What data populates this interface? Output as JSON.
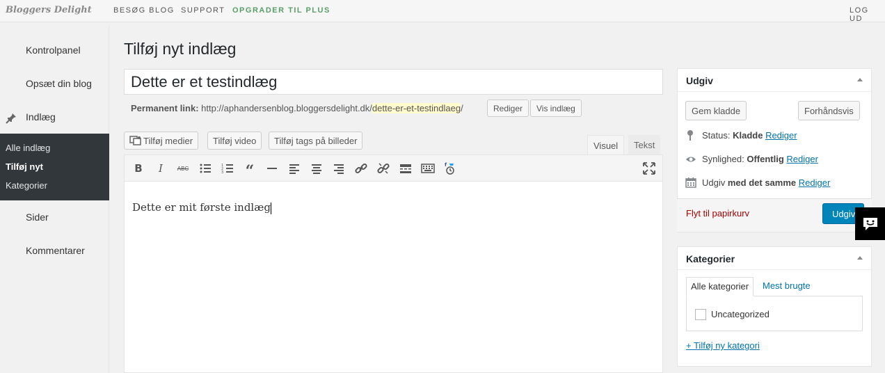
{
  "topbar": {
    "logo": "Bloggers Delight",
    "nav": [
      "BESØG BLOG",
      "SUPPORT",
      "OPGRADER TIL PLUS"
    ],
    "logout": "LOG UD"
  },
  "sidebar": {
    "items": [
      "Kontrolpanel",
      "Opsæt din blog",
      "Indlæg",
      "Sider",
      "Kommentarer"
    ],
    "submenu": [
      "Alle indlæg",
      "Tilføj nyt",
      "Kategorier"
    ]
  },
  "main": {
    "page_title": "Tilføj nyt indlæg",
    "post_title": "Dette er et testindlæg",
    "permalink_label": "Permanent link:",
    "permalink_base": "http://aphandersenblog.bloggersdelight.dk/",
    "permalink_slug": "dette-er-et-testindlaeg",
    "permalink_trail": "/",
    "edit_button": "Rediger",
    "view_button": "Vis indlæg",
    "media_buttons": [
      "Tilføj medier",
      "Tilføj video",
      "Tilføj tags på billeder"
    ],
    "tabs": [
      "Visuel",
      "Tekst"
    ],
    "content": "Dette er mit første indlæg"
  },
  "publish_box": {
    "title": "Udgiv",
    "save_draft": "Gem kladde",
    "preview": "Forhåndsvis",
    "status_label": "Status:",
    "status_value": "Kladde",
    "visibility_label": "Synlighed:",
    "visibility_value": "Offentlig",
    "publish_label": "Udgiv",
    "publish_value": "med det samme",
    "edit_link": "Rediger",
    "trash": "Flyt til papirkurv",
    "publish_button": "Udgiv"
  },
  "categories_box": {
    "title": "Kategorier",
    "tabs": [
      "Alle kategorier",
      "Mest brugte"
    ],
    "items": [
      "Uncategorized"
    ],
    "add_link": "+ Tilføj ny kategori"
  },
  "colors": {
    "accent": "#0085ba",
    "link": "#0073aa",
    "sidebar_active": "#32373c",
    "trash": "#aa0000",
    "upgrade": "#5a9e6a"
  }
}
